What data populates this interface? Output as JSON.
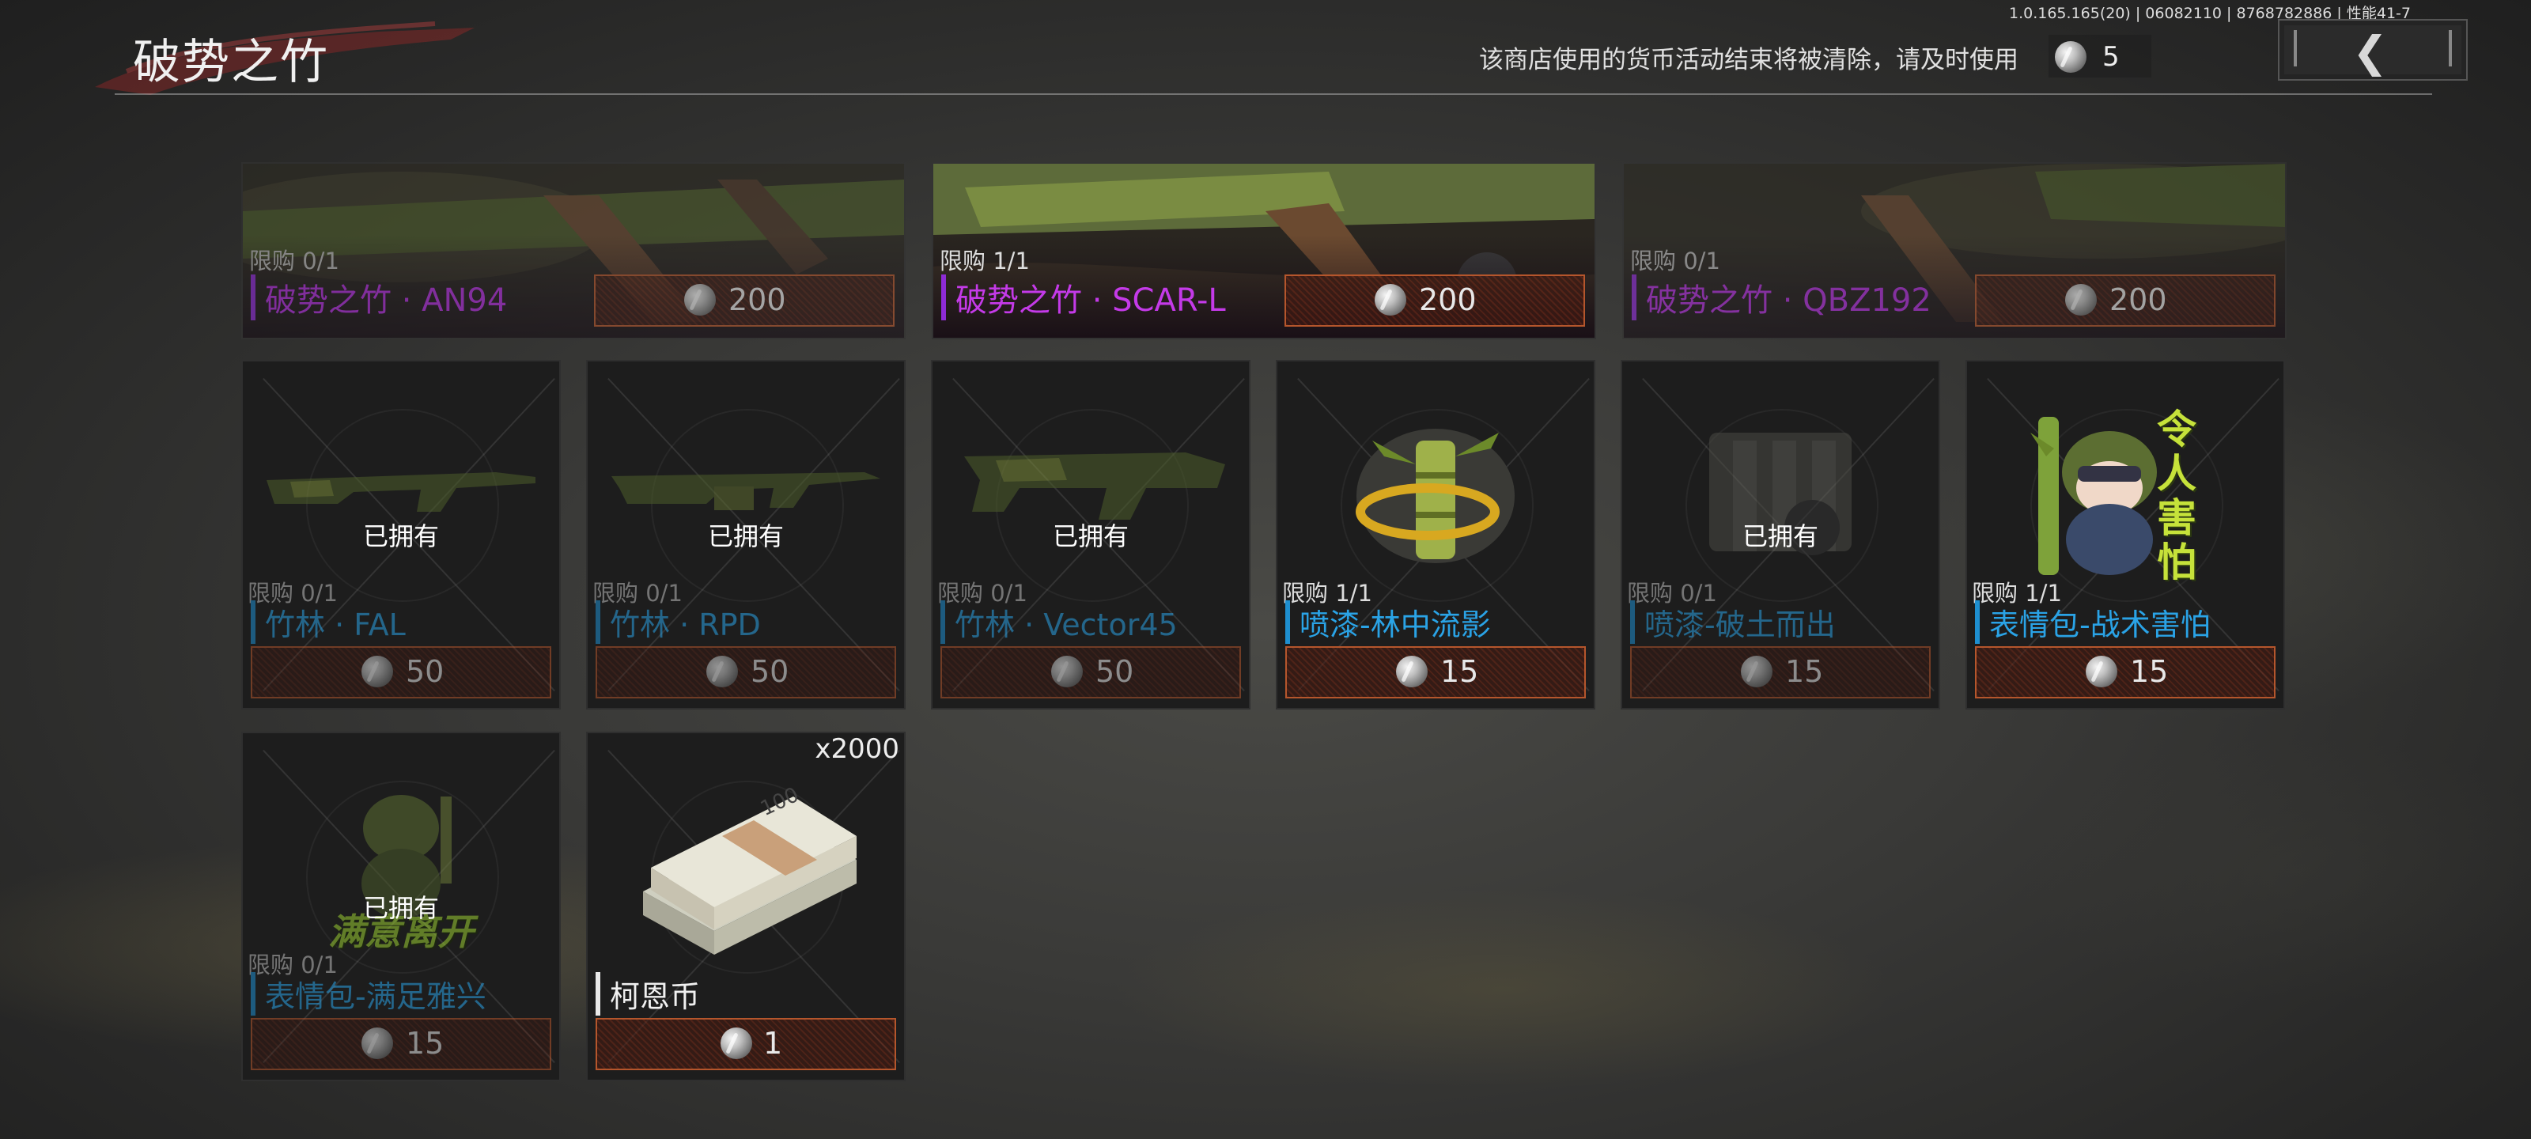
{
  "header": {
    "title": "破势之竹",
    "version": "1.0.165.165(20) | 06082110 | 8768782886 | 性能41-7",
    "notice": "该商店使用的货币活动结束将被清除，请及时使用",
    "currency_amount": "5"
  },
  "featured": [
    {
      "limit": "限购 0/1",
      "name": "破势之竹 · AN94",
      "price": "200",
      "owned": true
    },
    {
      "limit": "限购 1/1",
      "name": "破势之竹 · SCAR-L",
      "price": "200",
      "owned": false
    },
    {
      "limit": "限购 0/1",
      "name": "破势之竹 · QBZ192",
      "price": "200",
      "owned": true
    }
  ],
  "items": [
    {
      "limit": "限购 0/1",
      "name": "竹林 · FAL",
      "price": "50",
      "owned_label": "已拥有"
    },
    {
      "limit": "限购 0/1",
      "name": "竹林 · RPD",
      "price": "50",
      "owned_label": "已拥有"
    },
    {
      "limit": "限购 0/1",
      "name": "竹林 · Vector45",
      "price": "50",
      "owned_label": "已拥有"
    },
    {
      "limit": "限购 1/1",
      "name": "喷漆-林中流影",
      "price": "15"
    },
    {
      "limit": "限购 0/1",
      "name": "喷漆-破土而出",
      "price": "15",
      "owned_label": "已拥有"
    },
    {
      "limit": "限购 1/1",
      "name": "表情包-战术害怕",
      "price": "15",
      "emote_text": "令人害怕"
    },
    {
      "limit": "限购 0/1",
      "name": "表情包-满足雅兴",
      "price": "15",
      "owned_label": "已拥有",
      "emote_text": "满意离开"
    },
    {
      "name": "柯恩币",
      "price": "1",
      "quantity": "x2000",
      "banknote": "100"
    }
  ],
  "colors": {
    "purple": "#b32ee0",
    "blue": "#2aa3e6",
    "price_border": "#b5562c"
  }
}
